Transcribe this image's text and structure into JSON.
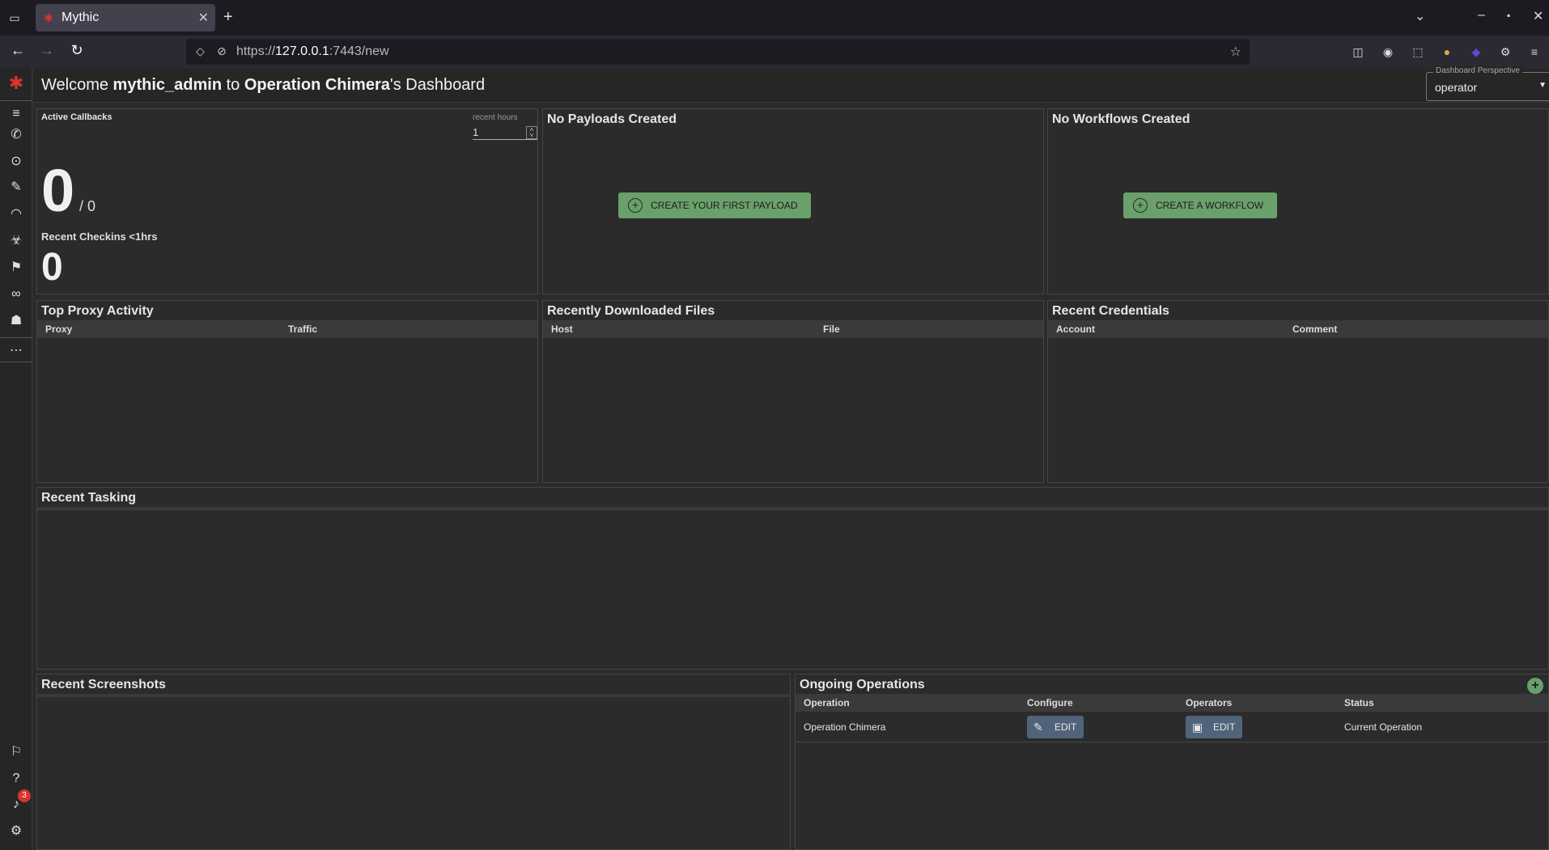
{
  "browser": {
    "tab_title": "Mythic",
    "url_prefix": "https://",
    "url_host": "127.0.0.1",
    "url_rest": ":7443/new"
  },
  "header": {
    "welcome_prefix": "Welcome ",
    "user": "mythic_admin",
    "middle": " to ",
    "operation": "Operation Chimera",
    "suffix": "'s Dashboard",
    "perspective_label": "Dashboard Perspective",
    "perspective_value": "operator"
  },
  "active_callbacks": {
    "title": "Active Callbacks",
    "recent_hours_label": "recent hours",
    "recent_hours_value": "1",
    "count": "0",
    "total": "/ 0",
    "checkins_label": "Recent Checkins <1hrs",
    "checkins_count": "0"
  },
  "payloads": {
    "title": "No Payloads Created",
    "button": "CREATE YOUR FIRST PAYLOAD"
  },
  "workflows": {
    "title": "No Workflows Created",
    "button": "CREATE A WORKFLOW"
  },
  "proxy": {
    "title": "Top Proxy Activity",
    "col1": "Proxy",
    "col2": "Traffic"
  },
  "downloads": {
    "title": "Recently Downloaded Files",
    "col1": "Host",
    "col2": "File"
  },
  "credentials": {
    "title": "Recent Credentials",
    "col1": "Account",
    "col2": "Comment"
  },
  "tasking": {
    "title": "Recent Tasking"
  },
  "screenshots": {
    "title": "Recent Screenshots"
  },
  "operations": {
    "title": "Ongoing Operations",
    "columns": [
      "Operation",
      "Configure",
      "Operators",
      "Status"
    ],
    "rows": [
      {
        "operation": "Operation Chimera",
        "configure": "EDIT",
        "operators": "EDIT",
        "status": "Current Operation"
      }
    ]
  },
  "notifications_count": "3",
  "colors": {
    "accent_red": "#d9342b",
    "green_button": "#6aa06a",
    "edit_button": "#51637a"
  }
}
